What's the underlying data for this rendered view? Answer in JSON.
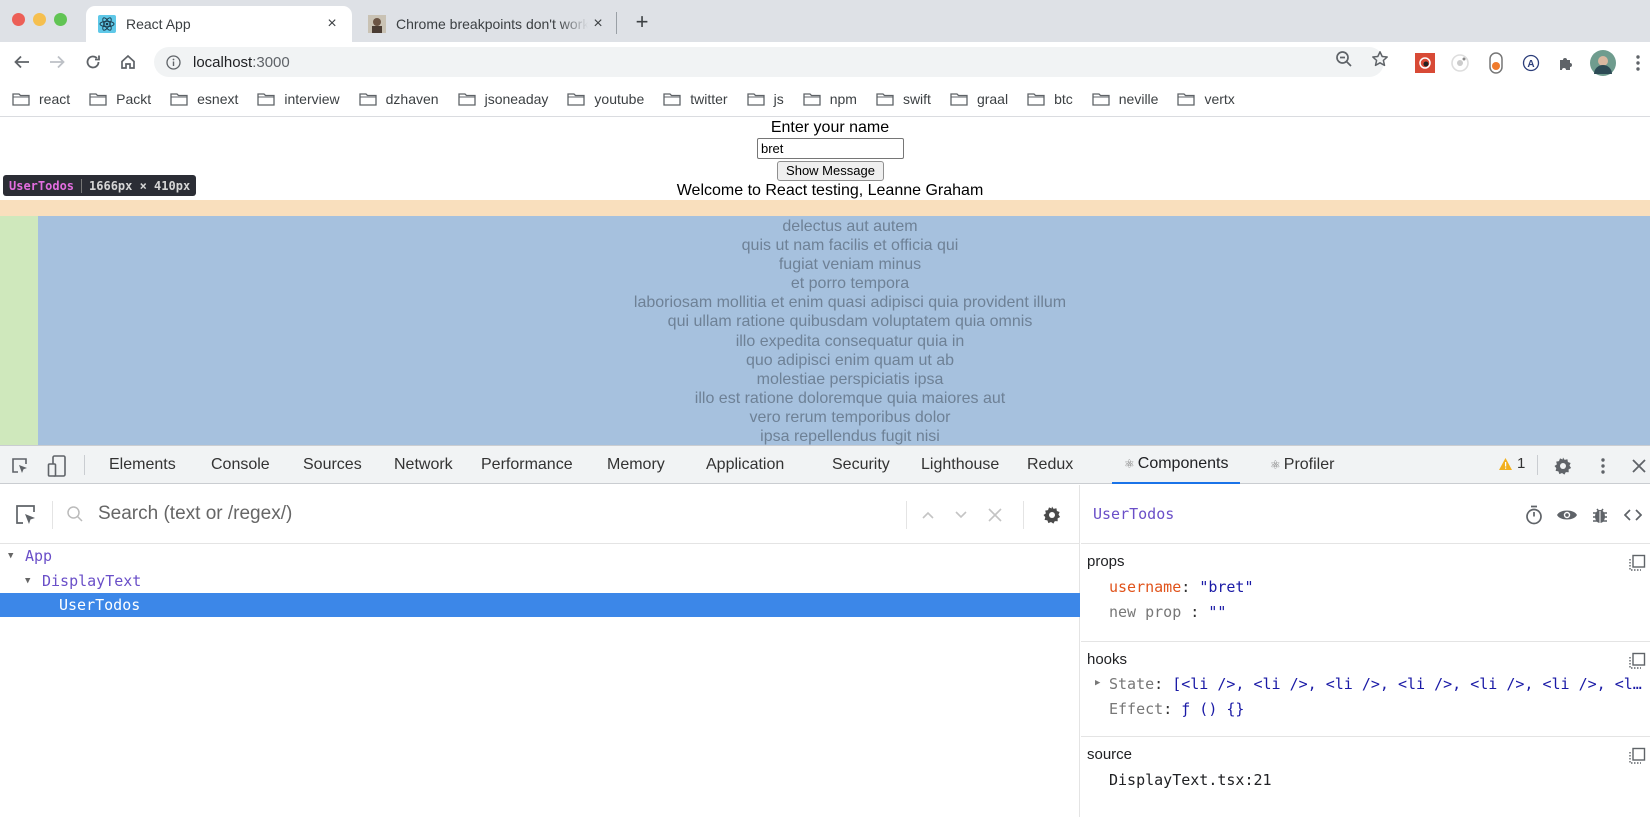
{
  "browser": {
    "tabs": [
      {
        "title": "React App",
        "favicon": "react-icon",
        "active": true
      },
      {
        "title": "Chrome breakpoints don't work",
        "favicon": "user-photo-icon",
        "active": false
      }
    ],
    "new_tab_label": "+",
    "close_label": "×",
    "url_host": "localhost",
    "url_port": ":3000",
    "extensions": [
      "red-paw-extension-icon",
      "target-extension-icon",
      "toggle-extension-icon",
      "a-circle-extension-icon",
      "puzzle-extensions-icon",
      "profile-avatar"
    ],
    "bookmarks": [
      "react",
      "Packt",
      "esnext",
      "interview",
      "dzhaven",
      "jsoneaday",
      "youtube",
      "twitter",
      "js",
      "npm",
      "swift",
      "graal",
      "btc",
      "neville",
      "vertx"
    ]
  },
  "page": {
    "label": "Enter your name",
    "input_value": "bret",
    "button_label": "Show Message",
    "welcome": "Welcome to React testing, Leanne Graham",
    "highlight_tooltip": {
      "name": "UserTodos",
      "size": "1666px × 410px"
    },
    "todos": [
      "delectus aut autem",
      "quis ut nam facilis et officia qui",
      "fugiat veniam minus",
      "et porro tempora",
      "laboriosam mollitia et enim quasi adipisci quia provident illum",
      "qui ullam ratione quibusdam voluptatem quia omnis",
      "illo expedita consequatur quia in",
      "quo adipisci enim quam ut ab",
      "molestiae perspiciatis ipsa",
      "illo est ratione doloremque quia maiores aut",
      "vero rerum temporibus dolor",
      "ipsa repellendus fugit nisi"
    ]
  },
  "devtools": {
    "tabs": [
      {
        "label": "Elements"
      },
      {
        "label": "Console"
      },
      {
        "label": "Sources"
      },
      {
        "label": "Network"
      },
      {
        "label": "Performance"
      },
      {
        "label": "Memory"
      },
      {
        "label": "Application"
      },
      {
        "label": "Security"
      },
      {
        "label": "Lighthouse"
      },
      {
        "label": "Redux"
      },
      {
        "label": "Components",
        "react_icon": "⚛",
        "selected": true
      },
      {
        "label": "Profiler",
        "react_icon": "⚛"
      }
    ],
    "warning_count": "1",
    "components": {
      "search_placeholder": "Search (text or /regex/)",
      "tree": [
        {
          "name": "App",
          "depth": 0,
          "expanded": true
        },
        {
          "name": "DisplayText",
          "depth": 1,
          "expanded": true
        },
        {
          "name": "UserTodos",
          "depth": 2,
          "selected": true
        }
      ],
      "inspected": {
        "name": "UserTodos",
        "props_title": "props",
        "props": [
          {
            "key": "username",
            "value": "\"bret\""
          },
          {
            "key": "new prop",
            "value": "\"\""
          }
        ],
        "hooks_title": "hooks",
        "hooks": [
          {
            "key": "State",
            "value": "[<li />, <li />, <li />, <li />, <li />, <li />, <l…"
          },
          {
            "key": "Effect",
            "value": "ƒ () {}"
          }
        ],
        "source_title": "source",
        "source": "DisplayText.tsx:21"
      }
    }
  }
}
